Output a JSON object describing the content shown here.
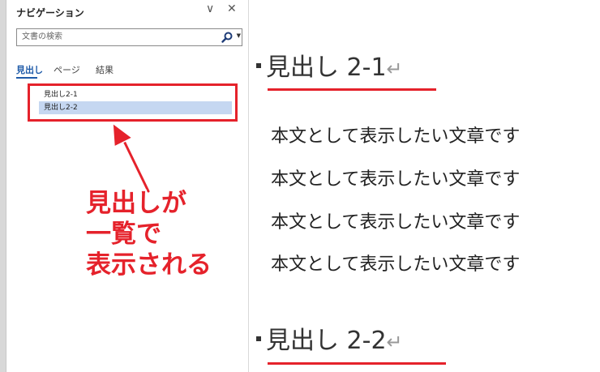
{
  "nav": {
    "title": "ナビゲーション",
    "minimize_glyph": "∨",
    "close_glyph": "✕",
    "search_placeholder": "文書の検索",
    "tabs": [
      {
        "label": "見出し",
        "active": true
      },
      {
        "label": "ページ",
        "active": false
      },
      {
        "label": "結果",
        "active": false
      }
    ],
    "headings": [
      {
        "label": "見出し2-1",
        "selected": false
      },
      {
        "label": "見出し2-2",
        "selected": true
      }
    ]
  },
  "callout": {
    "lines": [
      "見出しが",
      "一覧で",
      "表示される"
    ],
    "color": "#e5222b"
  },
  "document": {
    "headings": [
      {
        "text": "見出し 2-1",
        "mark": "↵"
      },
      {
        "text": "見出し 2-2",
        "mark": "↵"
      }
    ],
    "paragraphs": [
      "本文として表示したい文章です",
      "本文として表示したい文章です",
      "本文として表示したい文章です",
      "本文として表示したい文章です"
    ]
  }
}
